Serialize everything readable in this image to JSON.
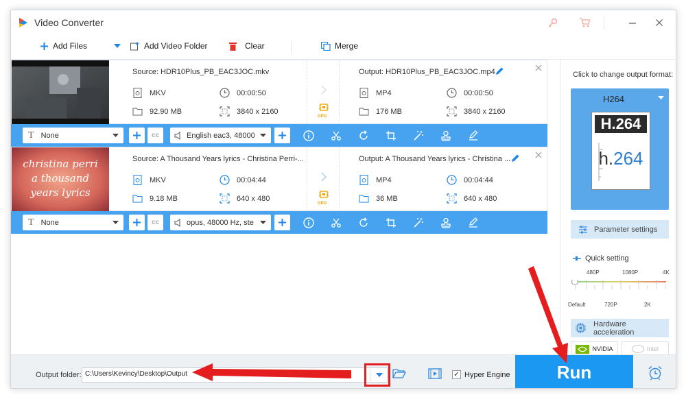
{
  "app": {
    "title": "Video Converter"
  },
  "colors": {
    "accent": "#47a3f0",
    "run": "#1a98f2",
    "annotation": "#e41e1e",
    "gpu": "#f0a000"
  },
  "toolbar": {
    "add_files": "Add Files",
    "add_folder": "Add Video Folder",
    "clear": "Clear",
    "merge": "Merge"
  },
  "files": [
    {
      "source": "Source: HDR10Plus_PB_EAC3JOC.mkv",
      "src_format": "MKV",
      "src_duration": "00:00:50",
      "src_size": "92.90 MB",
      "src_resolution": "3840 x 2160",
      "output": "Output: HDR10Plus_PB_EAC3JOC.mp4",
      "out_format": "MP4",
      "out_duration": "00:00:50",
      "out_size": "176 MB",
      "out_resolution": "3840 x 2160",
      "gpu": "GPU",
      "subtitle": "None",
      "audio": "English eac3, 48000"
    },
    {
      "source": "Source: A Thousand Years lyrics - Christina Perri-...",
      "src_format": "MKV",
      "src_duration": "00:04:44",
      "src_size": "9.18 MB",
      "src_resolution": "640 x 480",
      "output": "Output: A Thousand Years lyrics - Christina ...",
      "out_format": "MP4",
      "out_duration": "00:04:44",
      "out_size": "36 MB",
      "out_resolution": "640 x 480",
      "gpu": "GPU",
      "subtitle": "None",
      "audio": "opus, 48000 Hz, ste",
      "thumb_text": [
        "christina perri",
        "a thousand",
        "years lyrics"
      ]
    }
  ],
  "right_panel": {
    "label": "Click to change output format:",
    "format": "H264",
    "logo_top": "H.264",
    "logo_bottom_h": "h.",
    "logo_bottom_num": "264",
    "param_settings": "Parameter settings",
    "quick_setting": "Quick setting",
    "ticks_top": [
      "480P",
      "1080P",
      "4K"
    ],
    "ticks_bottom": [
      "Default",
      "720P",
      "2K"
    ],
    "hw_accel": "Hardware acceleration",
    "nvidia": "NVIDIA",
    "intel": "Intel"
  },
  "bottom": {
    "output_label": "Output folder:",
    "output_path": "C:\\Users\\Kevincy\\Desktop\\Output",
    "hyper_engine": "Hyper Engine",
    "hyper_checked": "✓",
    "run": "Run"
  }
}
